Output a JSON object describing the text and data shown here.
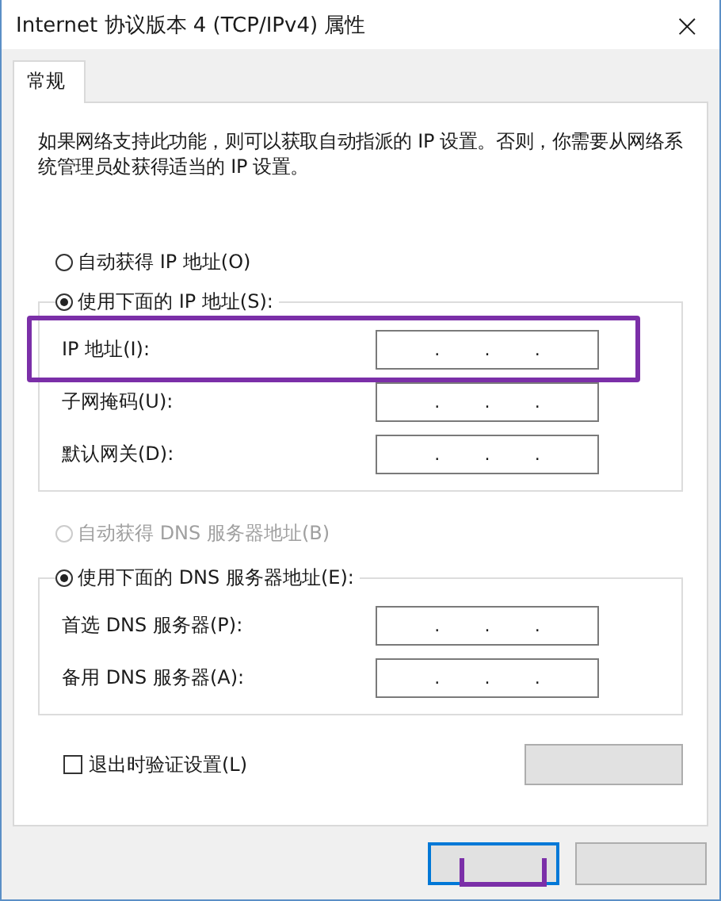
{
  "window": {
    "title": "Internet 协议版本 4 (TCP/IPv4) 属性",
    "close": "×"
  },
  "tabs": [
    {
      "label": "常规",
      "selected": true
    }
  ],
  "description": "如果网络支持此功能，则可以获取自动指派的 IP 设置。否则，你需要从网络系统管理员处获得适当的 IP 设置。",
  "sections": [
    {
      "options": [
        {
          "label": "自动获得 IP 地址(O)",
          "selected": false,
          "disabled": false
        },
        {
          "label": "使用下面的 IP 地址(S):",
          "selected": true,
          "disabled": false
        }
      ],
      "fields": [
        {
          "label": "IP 地址(I):",
          "separators": [
            ".",
            ".",
            "."
          ],
          "highlighted": true
        },
        {
          "label": "子网掩码(U):",
          "separators": [
            ".",
            ".",
            "."
          ],
          "highlighted": false
        },
        {
          "label": "默认网关(D):",
          "separators": [
            ".",
            ".",
            "."
          ],
          "highlighted": false
        }
      ]
    },
    {
      "options": [
        {
          "label": "自动获得 DNS 服务器地址(B)",
          "selected": false,
          "disabled": true
        },
        {
          "label": "使用下面的 DNS 服务器地址(E):",
          "selected": true,
          "disabled": false
        }
      ],
      "fields": [
        {
          "label": "首选 DNS 服务器(P):",
          "separators": [
            ".",
            ".",
            "."
          ],
          "highlighted": false
        },
        {
          "label": "备用 DNS 服务器(A):",
          "separators": [
            ".",
            ".",
            "."
          ],
          "highlighted": false
        }
      ]
    }
  ],
  "validate_on_exit": {
    "label": "退出时验证设置(L)",
    "checked": false
  },
  "buttons": [
    {
      "kind": "side",
      "highlighted": false
    },
    {
      "kind": "default",
      "highlighted": true
    },
    {
      "kind": "normal",
      "highlighted": false
    }
  ]
}
